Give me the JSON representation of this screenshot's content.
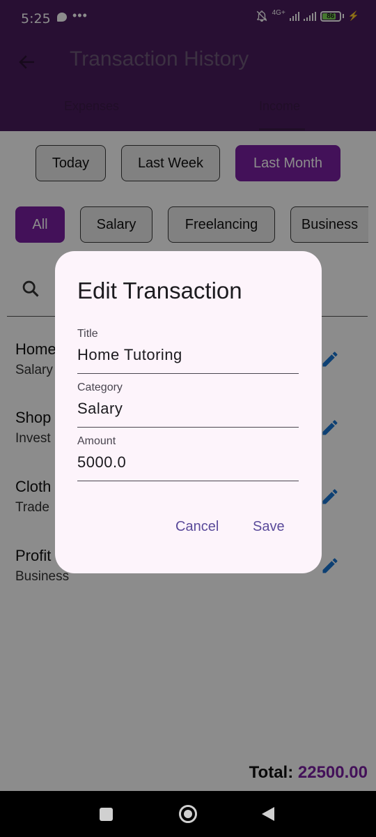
{
  "status_bar": {
    "time": "5:25",
    "dots": "•••",
    "network": "4G+",
    "battery": "86",
    "bolt": "⚡"
  },
  "app_bar": {
    "title": "Transaction History",
    "tabs": [
      {
        "label": "Expenses"
      },
      {
        "label": "Income",
        "selected": true
      }
    ]
  },
  "period_filters": [
    {
      "label": "Today",
      "selected": false
    },
    {
      "label": "Last Week",
      "selected": false
    },
    {
      "label": "Last Month",
      "selected": true
    }
  ],
  "category_filters": [
    {
      "label": "All",
      "selected": true
    },
    {
      "label": "Salary",
      "selected": false
    },
    {
      "label": "Freelancing",
      "selected": false
    },
    {
      "label": "Business",
      "selected": false
    }
  ],
  "transactions": [
    {
      "title": "Home",
      "category": "Salary"
    },
    {
      "title": "Shop",
      "category": "Invest"
    },
    {
      "title": "Cloth",
      "category": "Trade"
    },
    {
      "title": "Profit",
      "category": "Business"
    }
  ],
  "total": {
    "label": "Total:",
    "amount": "22500.00"
  },
  "dialog": {
    "title": "Edit Transaction",
    "fields": [
      {
        "label": "Title",
        "value": "Home Tutoring"
      },
      {
        "label": "Category",
        "value": "Salary"
      },
      {
        "label": "Amount",
        "value": "5000.0"
      }
    ],
    "cancel_label": "Cancel",
    "save_label": "Save"
  },
  "colors": {
    "primary": "#4a1c5e",
    "accent": "#7b1fa2",
    "edit_icon": "#1976d2",
    "dialog_bg": "#fdf4fb"
  }
}
